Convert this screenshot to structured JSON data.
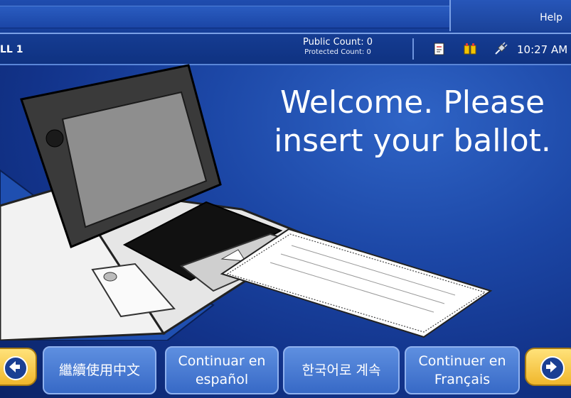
{
  "header": {
    "help_label": "Help"
  },
  "status": {
    "poll_label": "LL 1",
    "public_count": "Public Count: 0",
    "protected_count": "Protected Count: 0",
    "time": "10:27 AM",
    "icons": [
      "document-icon",
      "power-connector-icon",
      "plug-icon"
    ]
  },
  "main": {
    "welcome_text": "Welcome. Please insert your ballot."
  },
  "languages": [
    {
      "label": "繼續使用中文"
    },
    {
      "label": "Continuar en\nespañol"
    },
    {
      "label": "한국어로 계속"
    },
    {
      "label": "Continuer en\nFrançais"
    }
  ],
  "colors": {
    "background": "#1c47a6",
    "nav_button": "#f0b72c",
    "language_button": "#3769c6"
  }
}
